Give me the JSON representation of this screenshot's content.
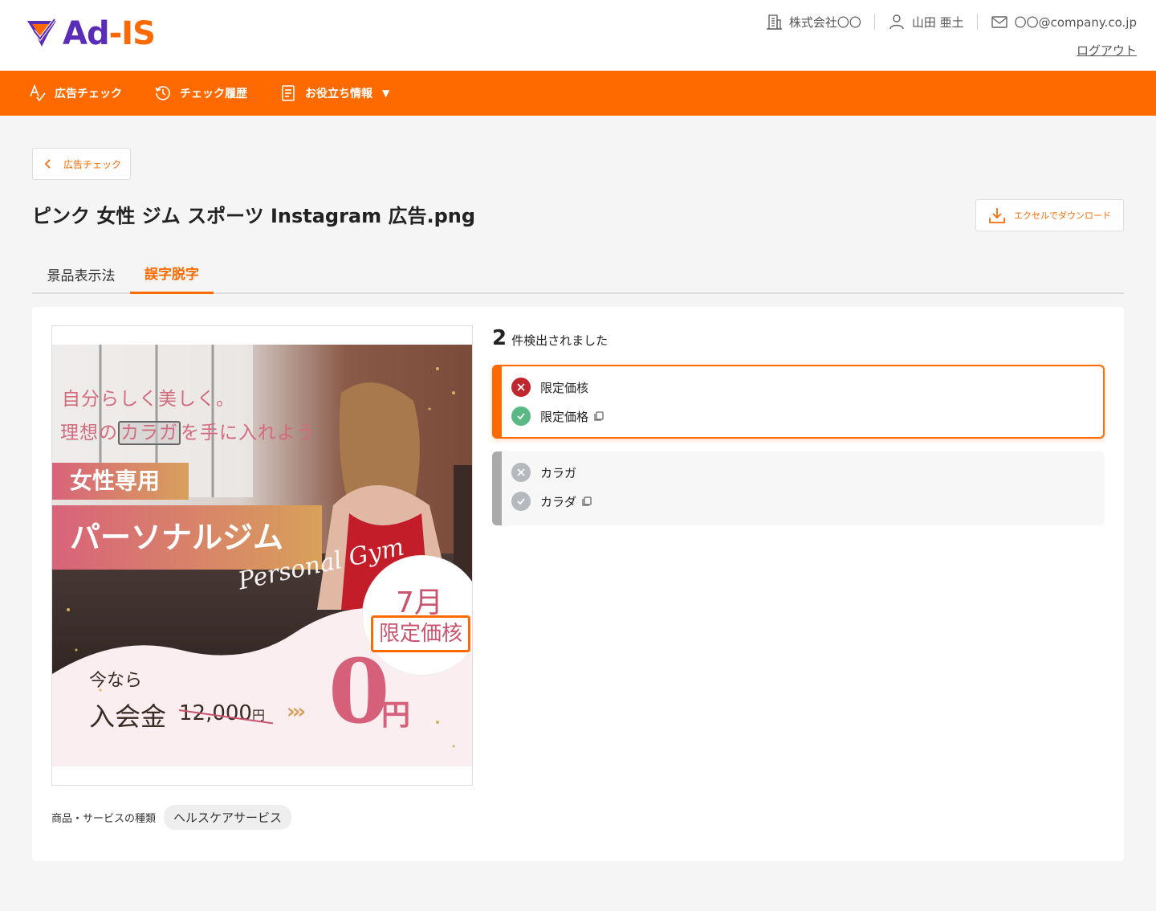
{
  "header": {
    "logo_text_1": "Ad",
    "logo_text_2": "-IS",
    "company": "株式会社〇〇",
    "user": "山田 亜土",
    "email": "〇〇@company.co.jp",
    "logout": "ログアウト"
  },
  "nav": {
    "items": [
      {
        "label": "広告チェック",
        "icon": "ad-check-icon"
      },
      {
        "label": "チェック履歴",
        "icon": "history-icon"
      },
      {
        "label": "お役立ち情報",
        "icon": "document-icon"
      }
    ],
    "caret": "▼"
  },
  "back_button": {
    "label": "広告チェック"
  },
  "page_title": "ピンク 女性 ジム スポーツ Instagram 広告.png",
  "download_button": {
    "label": "エクセルでダウンロード"
  },
  "tabs": [
    {
      "label": "景品表示法",
      "active": false
    },
    {
      "label": "誤字脱字",
      "active": true
    }
  ],
  "ad": {
    "line1": "自分らしく美しく。",
    "line2_pre": "理想の",
    "line2_hl": "カラガ",
    "line2_post": "を手に入れよう",
    "badge1": "女性専用",
    "badge2": "パーソナルジム",
    "script": "Personal Gym",
    "month": "7月",
    "limited": "限定価核",
    "now": "今なら",
    "fee": "入会金",
    "price": "12,000",
    "price_unit": "円",
    "arrows": "›››",
    "zero": "0",
    "yen": "円"
  },
  "category": {
    "label": "商品・サービスの種類",
    "value": "ヘルスケアサービス"
  },
  "results": {
    "count": "2",
    "count_label": "件検出されました",
    "items": [
      {
        "wrong": "限定価核",
        "correct": "限定価格",
        "selected": true
      },
      {
        "wrong": "カラガ",
        "correct": "カラダ",
        "selected": false
      }
    ]
  },
  "colors": {
    "accent": "#ff6a00",
    "brand_purple": "#5a2db8",
    "error": "#c0262d",
    "ok": "#5ab885"
  }
}
